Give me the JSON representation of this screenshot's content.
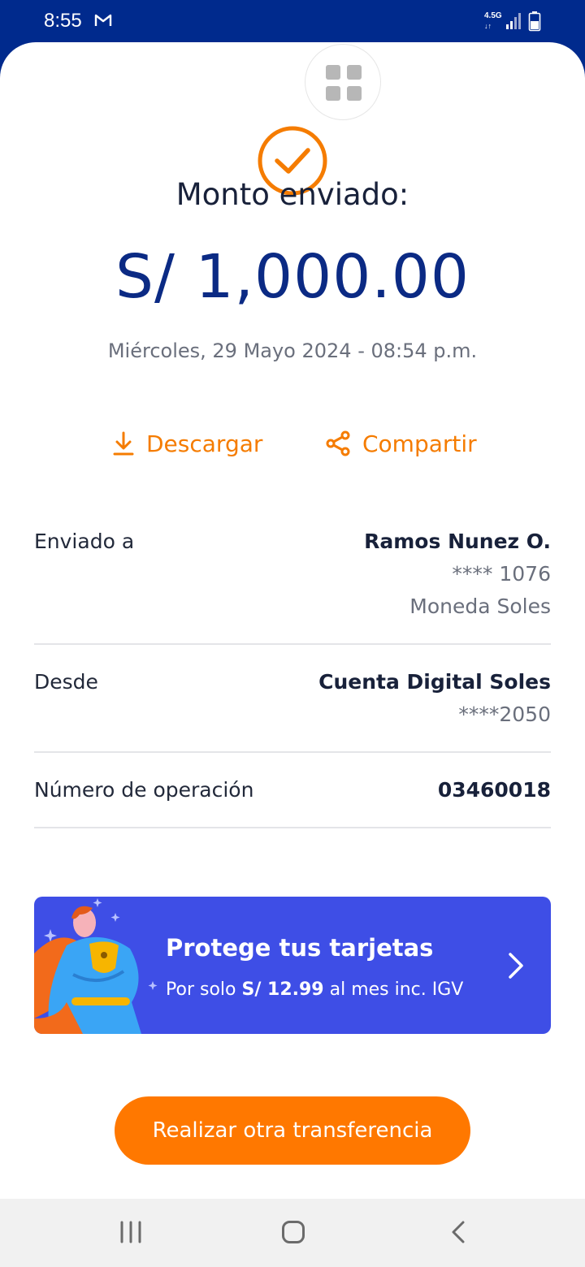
{
  "status_bar": {
    "time": "8:55",
    "network_line1": "4.5G",
    "network_line2": "↓↑",
    "icons": [
      "gmail-icon",
      "signal-icon",
      "battery-icon"
    ]
  },
  "receipt": {
    "title": "Monto enviado:",
    "amount": "S/ 1,000.00",
    "datetime": "Miércoles, 29 Mayo 2024 - 08:54 p.m.",
    "actions": {
      "download_label": "Descargar",
      "share_label": "Compartir"
    },
    "details": {
      "sent_to": {
        "label": "Enviado a",
        "name": "Ramos Nunez O.",
        "account": "**** 1076",
        "currency": "Moneda Soles"
      },
      "from": {
        "label": "Desde",
        "account_name": "Cuenta Digital Soles",
        "account": "****2050"
      },
      "operation": {
        "label": "Número de operación",
        "number": "03460018"
      }
    }
  },
  "promo": {
    "title": "Protege tus tarjetas",
    "subtitle_prefix": "Por solo ",
    "subtitle_price": "S/ 12.99",
    "subtitle_suffix": " al mes inc. IGV"
  },
  "cta_label": "Realizar otra transferencia",
  "colors": {
    "brand_blue": "#002a8d",
    "amount_blue": "#0b2a84",
    "accent_orange": "#ff7800",
    "promo_blue": "#3e4ee6"
  }
}
